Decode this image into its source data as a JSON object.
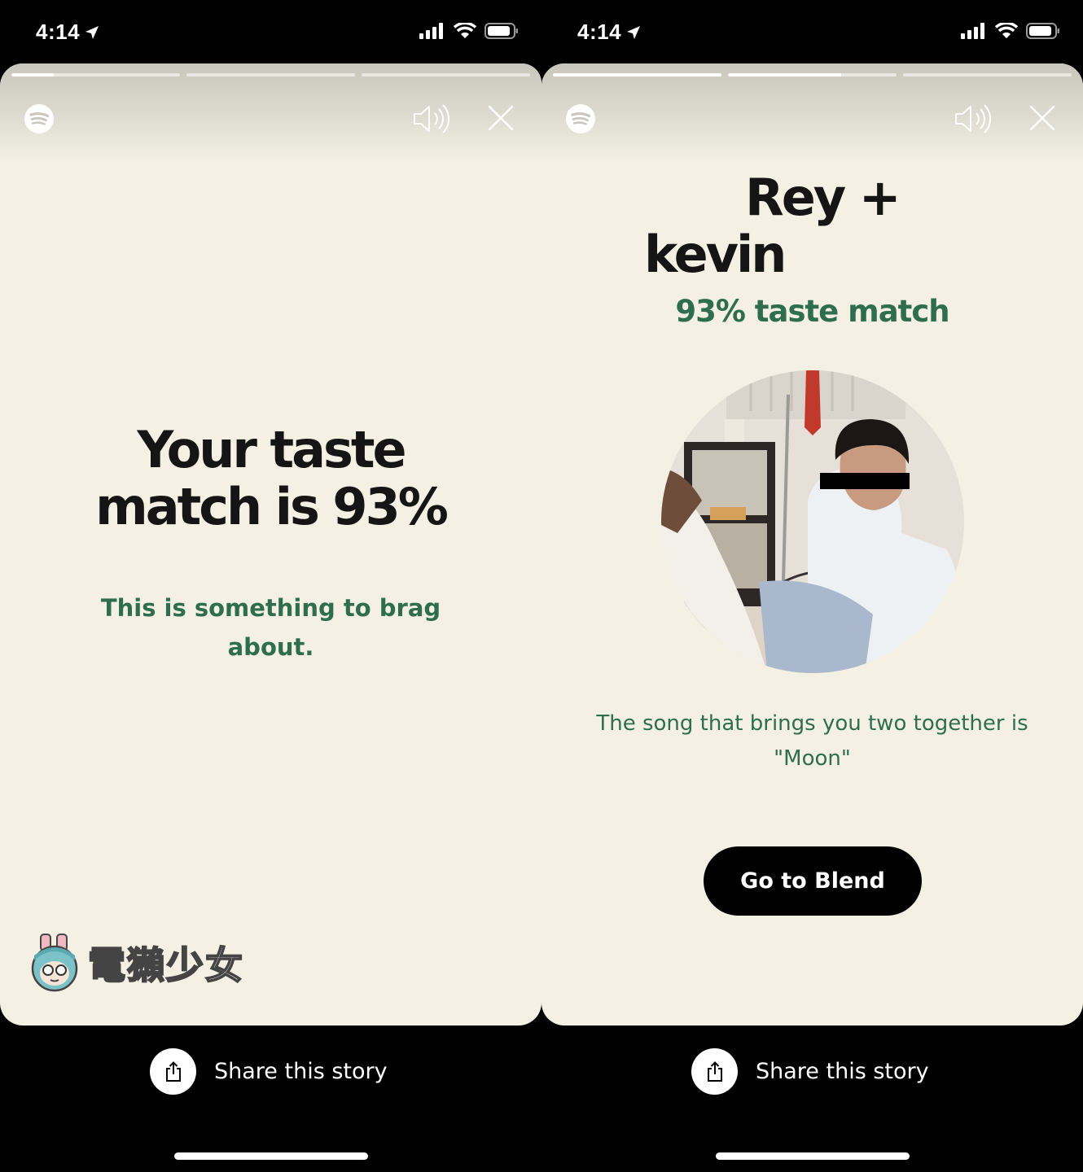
{
  "screens": [
    {
      "status": {
        "time": "4:14"
      },
      "progress": [
        0.25,
        0.0,
        0.0
      ],
      "headline_line1": "Your taste",
      "headline_line2": "match is 93%",
      "subline_line1": "This is something to brag",
      "subline_line2": "about.",
      "watermark": "電獺少女",
      "share_label": "Share this story"
    },
    {
      "status": {
        "time": "4:14"
      },
      "progress": [
        1.0,
        0.67,
        0.0
      ],
      "name_line1": "Rey +",
      "name_line2": "kevin",
      "match_text": "93% taste match",
      "song_line1": "The song that brings you two together is",
      "song_line2": "\"Moon\"",
      "button_label": "Go to Blend",
      "share_label": "Share this story"
    }
  ],
  "icons": {
    "brand": "spotify-icon",
    "volume": "volume-icon",
    "close": "close-icon",
    "share": "share-icon",
    "location": "location-arrow-icon",
    "signal": "signal-icon",
    "wifi": "wifi-icon",
    "battery": "battery-icon"
  },
  "colors": {
    "card_background": "#f4f1e4",
    "accent_green": "#2e6e4f",
    "headline": "#151515"
  }
}
